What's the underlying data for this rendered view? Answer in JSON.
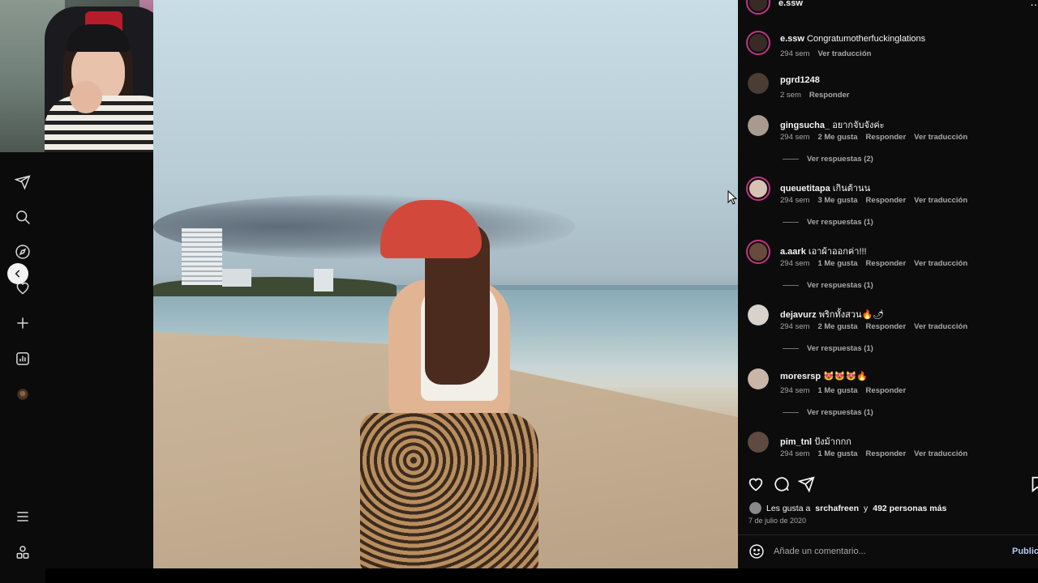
{
  "post": {
    "author": "e.ssw",
    "caption": {
      "user": "e.ssw",
      "text": "Congratumotherfuckinglations",
      "time": "294 sem",
      "translate": "Ver traducción"
    },
    "comments": [
      {
        "user": "pgrd1248",
        "text": "",
        "time": "2 sem",
        "likes": "",
        "reply": "Responder",
        "translate": "",
        "replies": ""
      },
      {
        "user": "gingsucha_",
        "text": "อยากจับจังค่ะ",
        "time": "294 sem",
        "likes": "2 Me gusta",
        "reply": "Responder",
        "translate": "Ver traducción",
        "replies": "Ver respuestas (2)"
      },
      {
        "user": "queuetitapa",
        "text": "เกินต้านน",
        "time": "294 sem",
        "likes": "3 Me gusta",
        "reply": "Responder",
        "translate": "Ver traducción",
        "replies": "Ver respuestas (1)"
      },
      {
        "user": "a.aark",
        "text": "เอาผ้าออกค่า!!!",
        "time": "294 sem",
        "likes": "1 Me gusta",
        "reply": "Responder",
        "translate": "Ver traducción",
        "replies": "Ver respuestas (1)"
      },
      {
        "user": "dejavurz",
        "text": "พริกทั้งสวน🔥🌶",
        "time": "294 sem",
        "likes": "2 Me gusta",
        "reply": "Responder",
        "translate": "Ver traducción",
        "replies": "Ver respuestas (1)"
      },
      {
        "user": "moresrsp",
        "text": "😻😻😻🔥",
        "time": "294 sem",
        "likes": "1 Me gusta",
        "reply": "Responder",
        "translate": "",
        "replies": "Ver respuestas (1)"
      },
      {
        "user": "pim_tnl",
        "text": "ปังม้ากกก",
        "time": "294 sem",
        "likes": "1 Me gusta",
        "reply": "Responder",
        "translate": "Ver traducción",
        "replies": ""
      }
    ],
    "likes_prefix": "Les gusta a",
    "likes_user": "srchafreen",
    "likes_conj": "y",
    "likes_others": "492 personas más",
    "date": "7 de julio de 2020",
    "comment_placeholder": "Añade un comentario...",
    "publish": "Publica"
  },
  "more_glyph": "…",
  "nav_icons": [
    "send-icon",
    "search-icon",
    "explore-icon",
    "heart-icon",
    "create-icon",
    "stats-icon",
    "profile-icon",
    "menu-icon",
    "more-apps-icon"
  ],
  "colors": {
    "panel_bg": "#0c0c0c",
    "muted": "#a8a8a8",
    "ring": "#c13584",
    "publish": "#b3c7f2"
  }
}
